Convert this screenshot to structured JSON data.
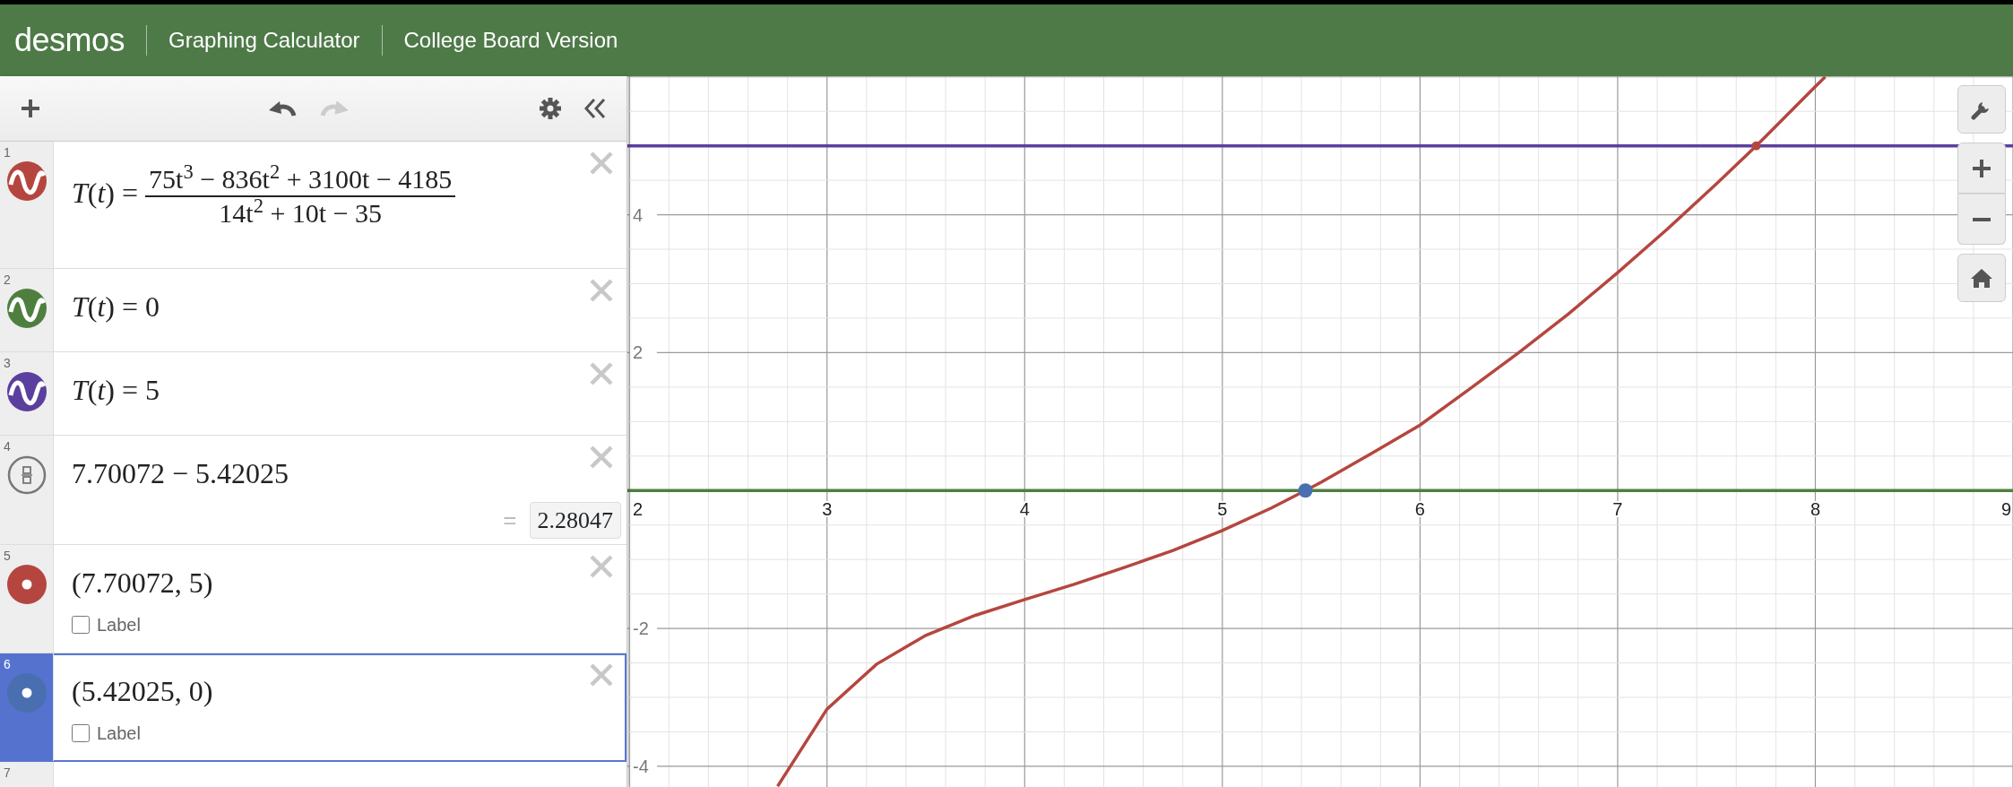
{
  "header": {
    "logo": "desmos",
    "title": "Graphing Calculator",
    "subtitle": "College Board Version"
  },
  "toolbar": {
    "redo_disabled": true
  },
  "expressions": [
    {
      "number": "1",
      "kind": "function",
      "color": "#b5463f",
      "selected": false,
      "lhs": "*T*(*t*) =",
      "numerator": "75t$^{3}$ − 836t$^{2}$ + 3100t − 4185",
      "denominator": "14t$^{2}$ + 10t − 35"
    },
    {
      "number": "2",
      "kind": "function",
      "color": "#4f7f3f",
      "selected": false,
      "latex": "*T*(*t*) = 0"
    },
    {
      "number": "3",
      "kind": "function",
      "color": "#5b3f9e",
      "selected": false,
      "latex": "*T*(*t*) = 5"
    },
    {
      "number": "4",
      "kind": "calc",
      "selected": false,
      "latex": "7.70072 − 5.42025",
      "result_sign": "=",
      "result": "2.28047"
    },
    {
      "number": "5",
      "kind": "point",
      "color": "#b5463f",
      "selected": false,
      "latex": "(7.70072, 5)",
      "label": {
        "text": "Label",
        "checked": false
      }
    },
    {
      "number": "6",
      "kind": "point",
      "color": "#4a6fb0",
      "selected": true,
      "latex": "(5.42025, 0)",
      "label": {
        "text": "Label",
        "checked": false
      }
    },
    {
      "number": "7",
      "kind": "empty",
      "selected": false
    }
  ],
  "graph": {
    "chart_data": {
      "type": "line",
      "grid": true,
      "xlim": [
        1.99,
        9.0
      ],
      "ylim": [
        -4.3,
        6.01
      ],
      "xticks": [
        {
          "value": 2,
          "label": "2"
        },
        {
          "value": 3,
          "label": "3"
        },
        {
          "value": 4,
          "label": "4"
        },
        {
          "value": 5,
          "label": "5"
        },
        {
          "value": 6,
          "label": "6"
        },
        {
          "value": 7,
          "label": "7"
        },
        {
          "value": 8,
          "label": "8"
        },
        {
          "value": 9,
          "label": "9"
        }
      ],
      "yticks": [
        {
          "value": -4,
          "label": "-4"
        },
        {
          "value": -2,
          "label": "-2"
        },
        {
          "value": 2,
          "label": "2"
        },
        {
          "value": 4,
          "label": "4"
        }
      ],
      "x": [
        2,
        2.75,
        3,
        3.25,
        3.5,
        3.75,
        4,
        4.25,
        4.5,
        4.75,
        5,
        5.25,
        5.42025,
        5.5,
        5.75,
        6,
        6.25,
        6.5,
        6.75,
        7,
        7.25,
        7.5,
        7.70072,
        7.75,
        8,
        8.05,
        9
      ],
      "series": [
        {
          "color": "#b5463f",
          "values": [
            null,
            -4.29,
            -3.17,
            -2.52,
            -2.1,
            -1.81,
            -1.58,
            -1.36,
            -1.12,
            -0.87,
            -0.58,
            -0.25,
            0,
            0.12,
            0.53,
            0.95,
            1.47,
            2.0,
            2.56,
            3.16,
            3.79,
            4.45,
            5,
            5.14,
            5.86,
            6.0,
            null
          ]
        },
        {
          "color": "#4f7f3f",
          "values": [
            0,
            0,
            0,
            0,
            0,
            0,
            0,
            0,
            0,
            0,
            0,
            0,
            0,
            0,
            0,
            0,
            0,
            0,
            0,
            0,
            0,
            0,
            0,
            0,
            0,
            0,
            0
          ]
        },
        {
          "color": "#5b3f9e",
          "values": [
            5,
            5,
            5,
            5,
            5,
            5,
            5,
            5,
            5,
            5,
            5,
            5,
            5,
            5,
            5,
            5,
            5,
            5,
            5,
            5,
            5,
            5,
            5,
            5,
            5,
            5,
            5
          ]
        },
        {
          "color": "#b5463f",
          "marker": true,
          "values": [
            null,
            null,
            null,
            null,
            null,
            null,
            null,
            null,
            null,
            null,
            null,
            null,
            null,
            null,
            null,
            null,
            null,
            null,
            null,
            null,
            null,
            null,
            5,
            null,
            null,
            null,
            null
          ]
        },
        {
          "color": "#4a6fb0",
          "marker": true,
          "values": [
            null,
            null,
            null,
            null,
            null,
            null,
            null,
            null,
            null,
            null,
            null,
            null,
            0,
            null,
            null,
            null,
            null,
            null,
            null,
            null,
            null,
            null,
            null,
            null,
            null,
            null,
            null
          ]
        }
      ]
    }
  }
}
